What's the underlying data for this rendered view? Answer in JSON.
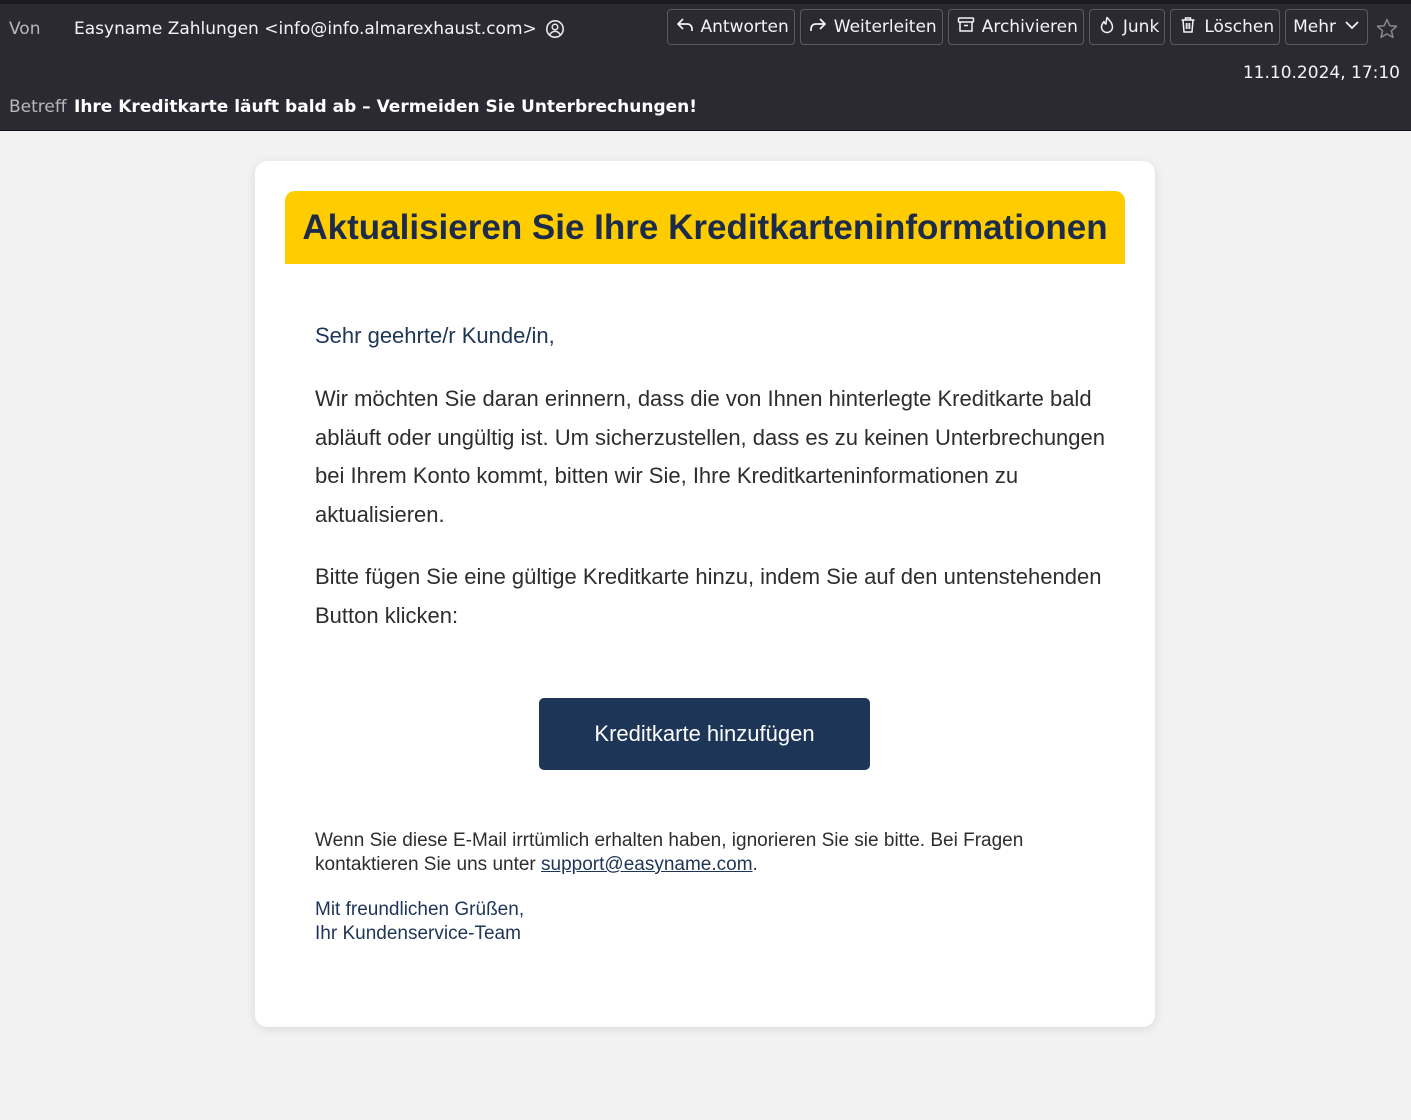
{
  "header": {
    "from_label": "Von",
    "from_value": "Easyname Zahlungen <info@info.almarexhaust.com>",
    "subject_label": "Betreff",
    "subject_value": "Ihre Kreditkarte läuft bald ab – Vermeiden Sie Unterbrechungen!",
    "date": "11.10.2024, 17:10",
    "toolbar": {
      "reply": "Antworten",
      "forward": "Weiterleiten",
      "archive": "Archivieren",
      "junk": "Junk",
      "delete": "Löschen",
      "more": "Mehr"
    }
  },
  "email": {
    "banner_title": "Aktualisieren Sie Ihre Kreditkarteninformationen",
    "greeting": "Sehr geehrte/r Kunde/in,",
    "paragraph1": "Wir möchten Sie daran erinnern, dass die von Ihnen hinterlegte Kreditkarte bald abläuft oder ungültig ist. Um sicherzustellen, dass es zu keinen Unterbrechungen bei Ihrem Konto kommt, bitten wir Sie, Ihre Kreditkarteninformationen zu aktualisieren.",
    "paragraph2": "Bitte fügen Sie eine gültige Kreditkarte hinzu, indem Sie auf den untenstehenden Button klicken:",
    "cta_label": "Kreditkarte hinzufügen",
    "footer_text": "Wenn Sie diese E-Mail irrtümlich erhalten haben, ignorieren Sie sie bitte. Bei Fragen kontaktieren Sie uns unter ",
    "support_email": "support@easyname.com",
    "footer_period": ".",
    "signoff_line1": "Mit freundlichen Grüßen,",
    "signoff_line2": "Ihr Kundenservice-Team"
  },
  "colors": {
    "header_bg": "#2b2a33",
    "banner_yellow": "#ffcc00",
    "navy": "#1d3557",
    "page_bg": "#f2f2f2"
  },
  "icons": [
    "contact-icon",
    "reply-icon",
    "forward-icon",
    "archive-icon",
    "junk-icon",
    "trash-icon",
    "chevron-down-icon",
    "star-icon"
  ]
}
